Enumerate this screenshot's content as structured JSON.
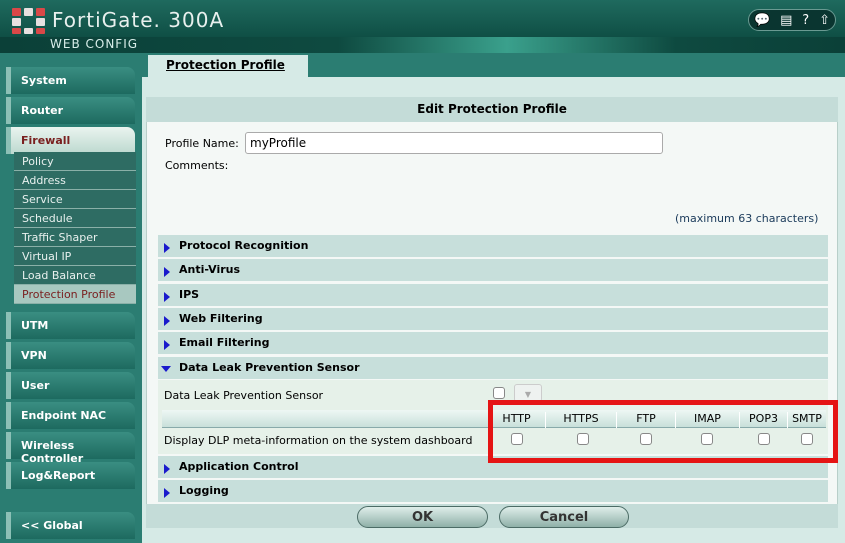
{
  "header": {
    "brand": "FortiGate. 300A",
    "subtitle": "WEB CONFIG",
    "icons": [
      "chat-icon",
      "save-icon",
      "help-icon",
      "logout-icon"
    ]
  },
  "sidebar": {
    "items": [
      {
        "label": "System"
      },
      {
        "label": "Router"
      },
      {
        "label": "Firewall"
      },
      {
        "label": "UTM"
      },
      {
        "label": "VPN"
      },
      {
        "label": "User"
      },
      {
        "label": "Endpoint NAC"
      },
      {
        "label": "Wireless Controller"
      },
      {
        "label": "Log&Report"
      },
      {
        "label": "<< Global"
      }
    ],
    "firewall_sub": [
      "Policy",
      "Address",
      "Service",
      "Schedule",
      "Traffic Shaper",
      "Virtual IP",
      "Load Balance",
      "Protection Profile"
    ]
  },
  "tab": "Protection Profile",
  "panel": {
    "title": "Edit Protection Profile",
    "profile_name_label": "Profile Name:",
    "profile_name_value": "myProfile",
    "comments_label": "Comments:",
    "comments_value": "",
    "comments_hint": "(maximum 63 characters)",
    "sections": [
      "Protocol Recognition",
      "Anti-Virus",
      "IPS",
      "Web Filtering",
      "Email Filtering",
      "Data Leak Prevention Sensor",
      "Application Control",
      "Logging"
    ],
    "dlp": {
      "sensor_label": "Data Leak Prevention Sensor",
      "meta_label": "Display DLP meta-information on the system dashboard",
      "columns": [
        "HTTP",
        "HTTPS",
        "FTP",
        "IMAP",
        "POP3",
        "SMTP"
      ]
    },
    "ok": "OK",
    "cancel": "Cancel"
  },
  "colors": {
    "highlight": "#e51414",
    "teal": "#2b7d72"
  }
}
